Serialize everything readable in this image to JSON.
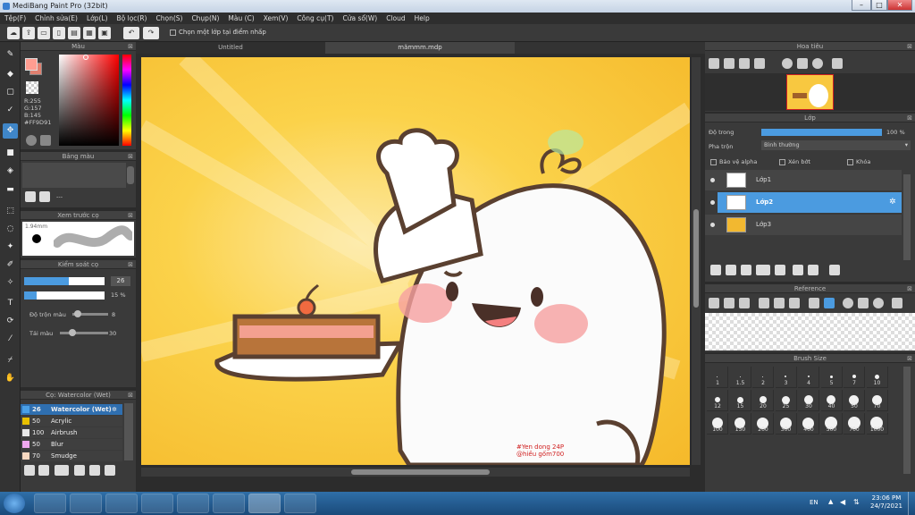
{
  "app": {
    "title": "MediBang Paint Pro (32bit)",
    "min": "–",
    "max": "□",
    "close": "✕"
  },
  "menu": [
    "Tệp(F)",
    "Chỉnh sửa(E)",
    "Lớp(L)",
    "Bộ lọc(R)",
    "Chọn(S)",
    "Chụp(N)",
    "Màu (C)",
    "Xem(V)",
    "Công cụ(T)",
    "Cửa sổ(W)",
    "Cloud",
    "Help"
  ],
  "toolbar": {
    "select_layer_label": "Chọn một lớp tại điểm nhấp",
    "undo": "↶",
    "redo": "↷"
  },
  "color_panel": {
    "title": "Màu",
    "r": "R:255",
    "g": "G:157",
    "b": "B:145",
    "hex": "#FF9D91",
    "primary": "#FF9D91",
    "secondary": "#ffffff"
  },
  "palette_panel": {
    "title": "Bảng màu",
    "dash": "---"
  },
  "brush_preview": {
    "title": "Xem trước cọ",
    "size": "1.94mm"
  },
  "brush_control": {
    "title": "Kiểm soát cọ",
    "size_value": "26",
    "opacity_value": "15 %",
    "blend_label": "Độ trộn màu",
    "blend_value": "8",
    "reload_label": "Tải màu",
    "reload_value": "30"
  },
  "brush_list": {
    "title": "Cọ: Watercolor (Wet)",
    "items": [
      {
        "size": "26",
        "name": "Watercolor (Wet)",
        "color": "#4aa0e8"
      },
      {
        "size": "50",
        "name": "Acrylic",
        "color": "#e8c000"
      },
      {
        "size": "100",
        "name": "Airbrush",
        "color": "#e8e8e8"
      },
      {
        "size": "50",
        "name": "Blur",
        "color": "#f0a8f0"
      },
      {
        "size": "70",
        "name": "Smudge",
        "color": "#f8d8c0"
      }
    ]
  },
  "doc_tabs": [
    "Untitled",
    "mămmm.mdp"
  ],
  "canvas": {
    "signature": "#Yen dong 24P\n@hiều gốm700"
  },
  "navigator": {
    "title": "Hoa tiêu"
  },
  "layer_panel": {
    "title": "Lớp",
    "opacity_label": "Độ trong",
    "opacity_value": "100 %",
    "blend_label": "Pha trộn",
    "blend_value": "Bình thường",
    "protect_alpha": "Bảo vệ alpha",
    "clipping": "Xén bớt",
    "lock": "Khóa",
    "layers": [
      "Lớp1",
      "Lớp2",
      "Lớp3"
    ],
    "selected": 1
  },
  "reference_panel": {
    "title": "Reference"
  },
  "brush_size_panel": {
    "title": "Brush Size",
    "sizes": [
      "1",
      "1.5",
      "2",
      "3",
      "4",
      "5",
      "7",
      "10",
      "12",
      "15",
      "20",
      "25",
      "30",
      "40",
      "50",
      "70",
      "100",
      "150",
      "200",
      "300",
      "400",
      "500",
      "700",
      "1000"
    ]
  },
  "taskbar": {
    "lang": "EN",
    "time": "23:06 PM",
    "date": "24/7/2021"
  }
}
